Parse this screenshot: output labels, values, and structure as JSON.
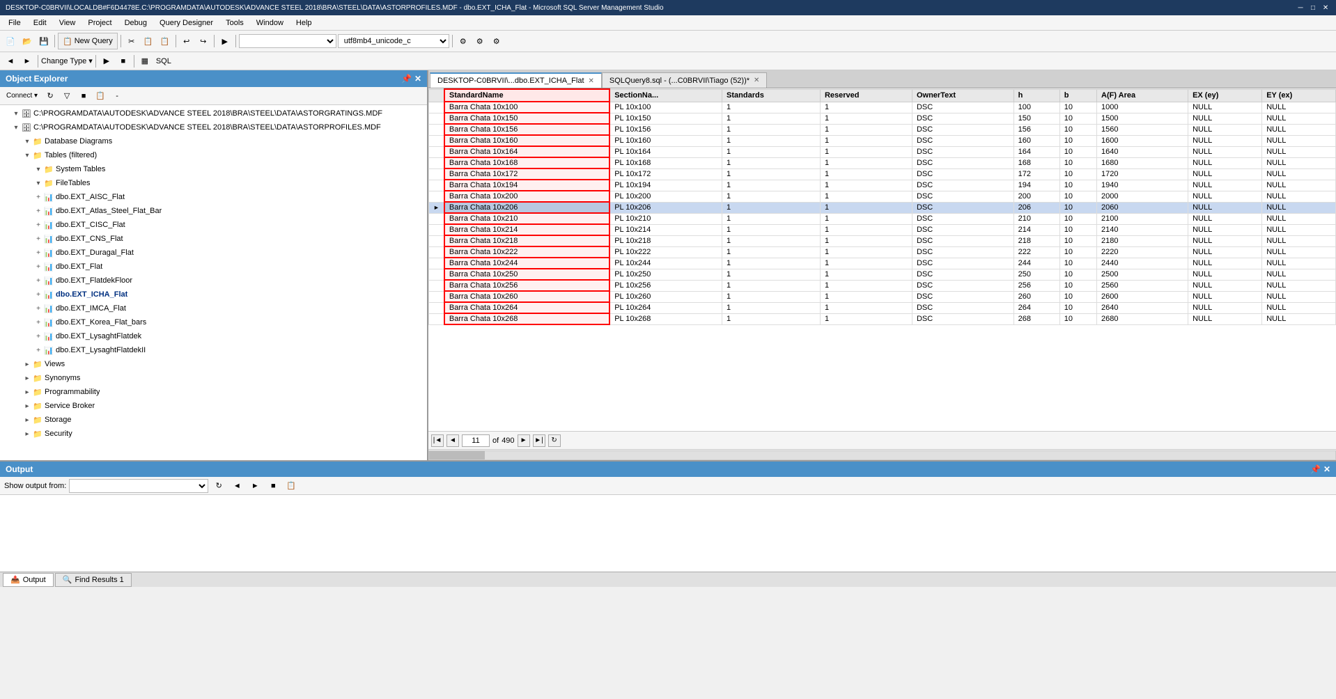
{
  "titleBar": {
    "text": "DESKTOP-C0BRVII\\LOCALDB#F6D4478E.C:\\PROGRAMDATA\\AUTODESK\\ADVANCE STEEL 2018\\BRA\\STEEL\\DATA\\ASTORPROFILES.MDF - dbo.EXT_ICHA_Flat - Microsoft SQL Server Management Studio",
    "minimize": "─",
    "restore": "□",
    "close": "✕"
  },
  "menuBar": {
    "items": [
      "File",
      "Edit",
      "View",
      "Project",
      "Debug",
      "Query Designer",
      "Tools",
      "Window",
      "Help"
    ]
  },
  "toolbar": {
    "newQuery": "New Query",
    "queryDesigner": "Query Designer",
    "encoding": "utf8mb4_unicode_c"
  },
  "objectExplorer": {
    "title": "Object Explorer",
    "connectBtn": "Connect ▾",
    "treeItems": [
      {
        "level": 1,
        "expanded": true,
        "icon": "db",
        "label": "C:\\PROGRAMDATA\\AUTODESK\\ADVANCE STEEL 2018\\BRA\\STEEL\\DATA\\ASTORGRATINGS.MDF"
      },
      {
        "level": 1,
        "expanded": true,
        "icon": "db",
        "label": "C:\\PROGRAMDATA\\AUTODESK\\ADVANCE STEEL 2018\\BRA\\STEEL\\DATA\\ASTORPROFILES.MDF"
      },
      {
        "level": 2,
        "expanded": true,
        "icon": "folder",
        "label": "Database Diagrams"
      },
      {
        "level": 2,
        "expanded": true,
        "icon": "folder",
        "label": "Tables (filtered)"
      },
      {
        "level": 3,
        "expanded": true,
        "icon": "folder",
        "label": "System Tables"
      },
      {
        "level": 3,
        "expanded": true,
        "icon": "folder",
        "label": "FileTables"
      },
      {
        "level": 3,
        "expanded": false,
        "icon": "table",
        "label": "dbo.EXT_AISC_Flat"
      },
      {
        "level": 3,
        "expanded": false,
        "icon": "table",
        "label": "dbo.EXT_Atlas_Steel_Flat_Bar"
      },
      {
        "level": 3,
        "expanded": false,
        "icon": "table",
        "label": "dbo.EXT_CISC_Flat"
      },
      {
        "level": 3,
        "expanded": false,
        "icon": "table",
        "label": "dbo.EXT_CNS_Flat"
      },
      {
        "level": 3,
        "expanded": false,
        "icon": "table",
        "label": "dbo.EXT_Duragal_Flat"
      },
      {
        "level": 3,
        "expanded": false,
        "icon": "table",
        "label": "dbo.EXT_Flat"
      },
      {
        "level": 3,
        "expanded": false,
        "icon": "table",
        "label": "dbo.EXT_FlatdekFloor"
      },
      {
        "level": 3,
        "expanded": false,
        "icon": "table",
        "label": "dbo.EXT_ICHA_Flat"
      },
      {
        "level": 3,
        "expanded": false,
        "icon": "table",
        "label": "dbo.EXT_IMCA_Flat"
      },
      {
        "level": 3,
        "expanded": false,
        "icon": "table",
        "label": "dbo.EXT_Korea_Flat_bars"
      },
      {
        "level": 3,
        "expanded": false,
        "icon": "table",
        "label": "dbo.EXT_LysaghtFlatdek"
      },
      {
        "level": 3,
        "expanded": false,
        "icon": "table",
        "label": "dbo.EXT_LysaghtFlatdekII"
      },
      {
        "level": 2,
        "expanded": false,
        "icon": "folder",
        "label": "Views"
      },
      {
        "level": 2,
        "expanded": false,
        "icon": "folder",
        "label": "Synonyms"
      },
      {
        "level": 2,
        "expanded": false,
        "icon": "folder",
        "label": "Programmability"
      },
      {
        "level": 2,
        "expanded": false,
        "icon": "folder",
        "label": "Service Broker"
      },
      {
        "level": 2,
        "expanded": false,
        "icon": "folder",
        "label": "Storage"
      },
      {
        "level": 2,
        "expanded": false,
        "icon": "folder",
        "label": "Security"
      }
    ]
  },
  "tabs": [
    {
      "label": "DESKTOP-C0BRVII\\...dbo.EXT_ICHA_Flat",
      "active": true,
      "closable": true
    },
    {
      "label": "SQLQuery8.sql - (...C0BRVII\\Tiago (52))*",
      "active": false,
      "closable": true
    }
  ],
  "resultsTable": {
    "columns": [
      "",
      "StandardName",
      "SectionNa...",
      "Standards",
      "Reserved",
      "OwnerText",
      "h",
      "b",
      "A(F) Area",
      "EX (ey)",
      "EY (ex)"
    ],
    "rows": [
      [
        "",
        "Barra Chata 10x100",
        "PL 10x100",
        "1",
        "1",
        "DSC",
        "100",
        "10",
        "1000",
        "NULL",
        "NULL"
      ],
      [
        "",
        "Barra Chata 10x150",
        "PL 10x150",
        "1",
        "1",
        "DSC",
        "150",
        "10",
        "1500",
        "NULL",
        "NULL"
      ],
      [
        "",
        "Barra Chata 10x156",
        "PL 10x156",
        "1",
        "1",
        "DSC",
        "156",
        "10",
        "1560",
        "NULL",
        "NULL"
      ],
      [
        "",
        "Barra Chata 10x160",
        "PL 10x160",
        "1",
        "1",
        "DSC",
        "160",
        "10",
        "1600",
        "NULL",
        "NULL"
      ],
      [
        "",
        "Barra Chata 10x164",
        "PL 10x164",
        "1",
        "1",
        "DSC",
        "164",
        "10",
        "1640",
        "NULL",
        "NULL"
      ],
      [
        "",
        "Barra Chata 10x168",
        "PL 10x168",
        "1",
        "1",
        "DSC",
        "168",
        "10",
        "1680",
        "NULL",
        "NULL"
      ],
      [
        "",
        "Barra Chata 10x172",
        "PL 10x172",
        "1",
        "1",
        "DSC",
        "172",
        "10",
        "1720",
        "NULL",
        "NULL"
      ],
      [
        "",
        "Barra Chata 10x194",
        "PL 10x194",
        "1",
        "1",
        "DSC",
        "194",
        "10",
        "1940",
        "NULL",
        "NULL"
      ],
      [
        "",
        "Barra Chata 10x200",
        "PL 10x200",
        "1",
        "1",
        "DSC",
        "200",
        "10",
        "2000",
        "NULL",
        "NULL"
      ],
      [
        "►",
        "Barra Chata 10x206",
        "PL 10x206",
        "1",
        "1",
        "DSC",
        "206",
        "10",
        "2060",
        "NULL",
        "NULL"
      ],
      [
        "",
        "Barra Chata 10x210",
        "PL 10x210",
        "1",
        "1",
        "DSC",
        "210",
        "10",
        "2100",
        "NULL",
        "NULL"
      ],
      [
        "",
        "Barra Chata 10x214",
        "PL 10x214",
        "1",
        "1",
        "DSC",
        "214",
        "10",
        "2140",
        "NULL",
        "NULL"
      ],
      [
        "",
        "Barra Chata 10x218",
        "PL 10x218",
        "1",
        "1",
        "DSC",
        "218",
        "10",
        "2180",
        "NULL",
        "NULL"
      ],
      [
        "",
        "Barra Chata 10x222",
        "PL 10x222",
        "1",
        "1",
        "DSC",
        "222",
        "10",
        "2220",
        "NULL",
        "NULL"
      ],
      [
        "",
        "Barra Chata 10x244",
        "PL 10x244",
        "1",
        "1",
        "DSC",
        "244",
        "10",
        "2440",
        "NULL",
        "NULL"
      ],
      [
        "",
        "Barra Chata 10x250",
        "PL 10x250",
        "1",
        "1",
        "DSC",
        "250",
        "10",
        "2500",
        "NULL",
        "NULL"
      ],
      [
        "",
        "Barra Chata 10x256",
        "PL 10x256",
        "1",
        "1",
        "DSC",
        "256",
        "10",
        "2560",
        "NULL",
        "NULL"
      ],
      [
        "",
        "Barra Chata 10x260",
        "PL 10x260",
        "1",
        "1",
        "DSC",
        "260",
        "10",
        "2600",
        "NULL",
        "NULL"
      ],
      [
        "",
        "Barra Chata 10x264",
        "PL 10x264",
        "1",
        "1",
        "DSC",
        "264",
        "10",
        "2640",
        "NULL",
        "NULL"
      ],
      [
        "",
        "Barra Chata 10x268",
        "PL 10x268",
        "1",
        "1",
        "DSC",
        "268",
        "10",
        "2680",
        "NULL",
        "NULL"
      ]
    ],
    "currentRow": 11,
    "totalRows": 490,
    "pageRow": 11
  },
  "navigator": {
    "first": "|◄",
    "prev": "◄",
    "next": "►",
    "last": "►|",
    "refresh": "↻",
    "currentRow": "11",
    "ofLabel": "of",
    "totalRows": "490"
  },
  "outputPanel": {
    "title": "Output",
    "showLabel": "Show output from:",
    "dropdownValue": ""
  },
  "bottomTabs": [
    {
      "label": "Output",
      "icon": "output",
      "active": true
    },
    {
      "label": "Find Results 1",
      "icon": "find",
      "active": false
    }
  ]
}
